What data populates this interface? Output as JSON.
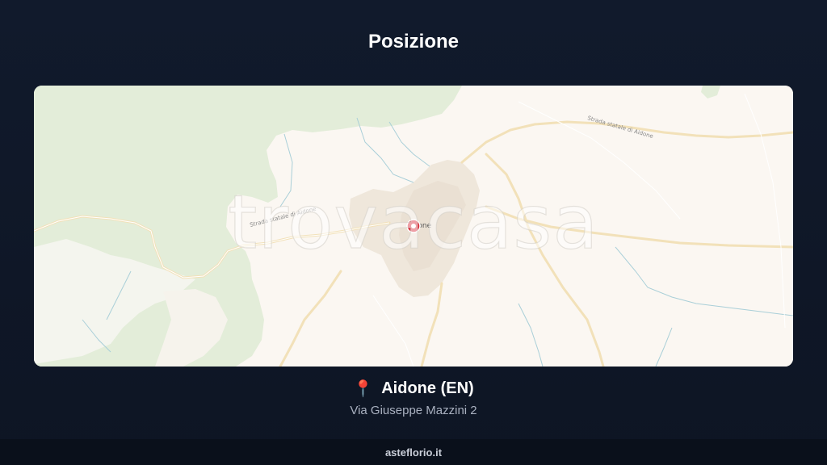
{
  "page": {
    "title": "Posizione"
  },
  "map": {
    "watermark": "trovacasa",
    "road_labels": [
      "Strada statale di Aidone",
      "Strada statale di Aidone"
    ],
    "town_label": "Aidone",
    "marker_icon": "map-pin-icon",
    "colors": {
      "land": "#fbf7f2",
      "forest": "#e4eedb",
      "road": "#f3e3bf",
      "river": "#a9cfd8",
      "marker": "#d92c3a"
    }
  },
  "location": {
    "pin_icon": "📍",
    "name": "Aidone (EN)",
    "address": "Via Giuseppe Mazzini 2"
  },
  "footer": {
    "site": "asteflorio.it"
  }
}
